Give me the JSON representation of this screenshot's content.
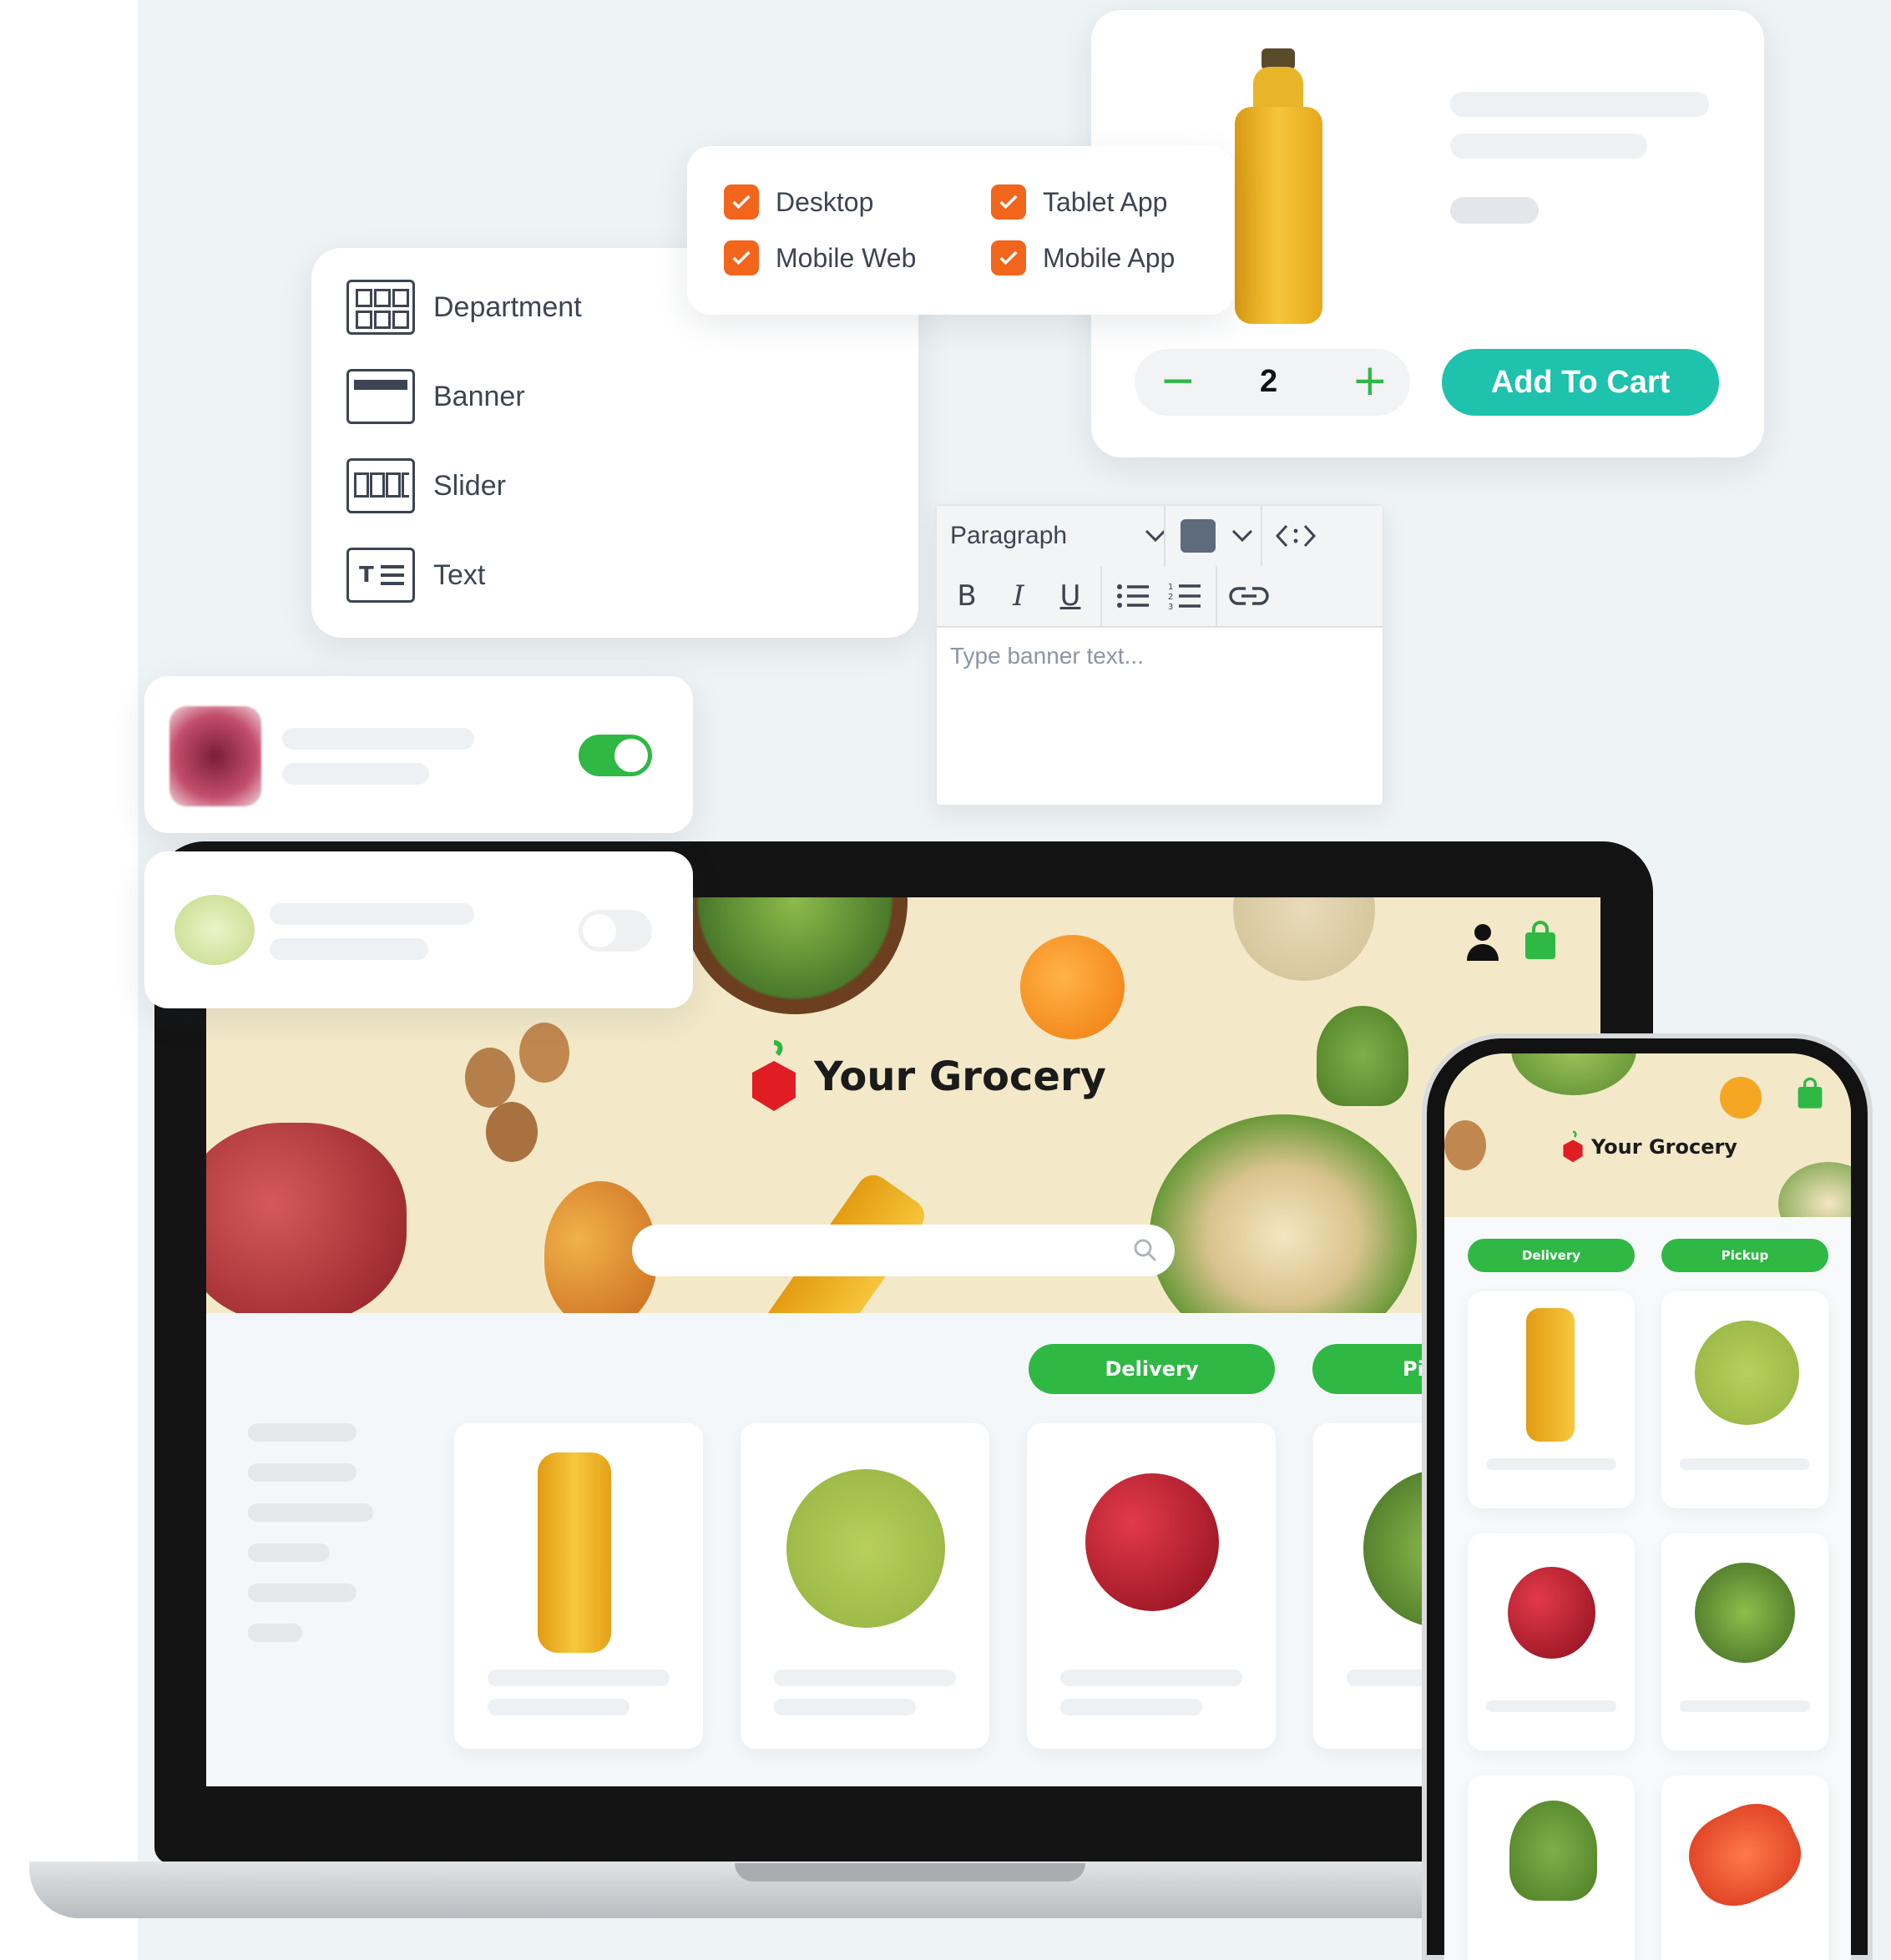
{
  "product_card": {
    "quantity": "2",
    "minus_symbol": "−",
    "plus_symbol": "+",
    "add_to_cart_label": "Add To Cart"
  },
  "platforms": [
    {
      "label": "Desktop",
      "checked": true
    },
    {
      "label": "Tablet App",
      "checked": true
    },
    {
      "label": "Mobile Web",
      "checked": true
    },
    {
      "label": "Mobile App",
      "checked": true
    }
  ],
  "modules": [
    {
      "label": "Department",
      "icon": "grid-icon"
    },
    {
      "label": "Banner",
      "icon": "banner-icon"
    },
    {
      "label": "Slider",
      "icon": "slider-icon"
    },
    {
      "label": "Text",
      "icon": "text-icon"
    }
  ],
  "editor": {
    "block_type": "Paragraph",
    "color_swatch": "#5d6b7d",
    "bold": "B",
    "italic": "I",
    "underline": "U",
    "placeholder": "Type banner text..."
  },
  "toggles": [
    {
      "on": true
    },
    {
      "on": false
    }
  ],
  "store": {
    "brand": "Your Grocery",
    "delivery_label": "Delivery",
    "pickup_label_partial": "Pi",
    "pickup_label": "Pickup"
  },
  "colors": {
    "accent_orange": "#f2651c",
    "teal": "#1ec2ad",
    "green": "#2fb844"
  }
}
